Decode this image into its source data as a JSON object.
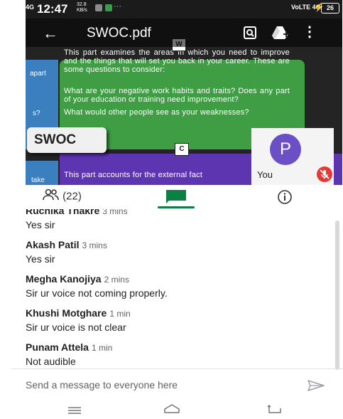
{
  "status_bar": {
    "signal_label": "4G",
    "time": "12:47",
    "speed": "32.8\nKB/s",
    "more": "···",
    "network": "VoLTE 4G",
    "battery": "26"
  },
  "pdf_viewer": {
    "title": "SWOC.pdf",
    "back_label": "←",
    "slide": {
      "w_badge": "W",
      "c_badge": "C",
      "side_label_1": "apart",
      "side_label_2": "s?",
      "side_label_3": "take",
      "green_paragraph": "This part examines the areas in which you need to improve and the things that will set you back in your career. These are some questions to consider:",
      "green_questions": "What are your negative work habits and traits? Does any part of your education or training need improvement?",
      "green_question_3": "What would other people see as your weaknesses?",
      "swoc_heading": "SWOC",
      "purple_text": "This part accounts for the external fact"
    },
    "self_tile": {
      "initial": "P",
      "label": "You"
    }
  },
  "tabs": {
    "people_count": "(22)"
  },
  "messages": [
    {
      "sender": "Ruchika Thakre",
      "ago": "3 mins",
      "text": "Yes sir"
    },
    {
      "sender": "Akash Patil",
      "ago": "3 mins",
      "text": "Yes sir"
    },
    {
      "sender": "Megha Kanojiya",
      "ago": "2 mins",
      "text": "Sir ur voice not coming properly."
    },
    {
      "sender": "Khushi Motghare",
      "ago": "1 min",
      "text": "Sir ur voice is not clear"
    },
    {
      "sender": "Punam Attela",
      "ago": "1 min",
      "text": "Not audible"
    }
  ],
  "composer": {
    "placeholder": "Send a message to everyone here"
  },
  "colors": {
    "accent_green": "#0b8043",
    "slide_green": "#3f9e43",
    "slide_purple": "#5e35b1",
    "avatar_purple": "#6a4fc7",
    "mic_off_red": "#e53935"
  }
}
